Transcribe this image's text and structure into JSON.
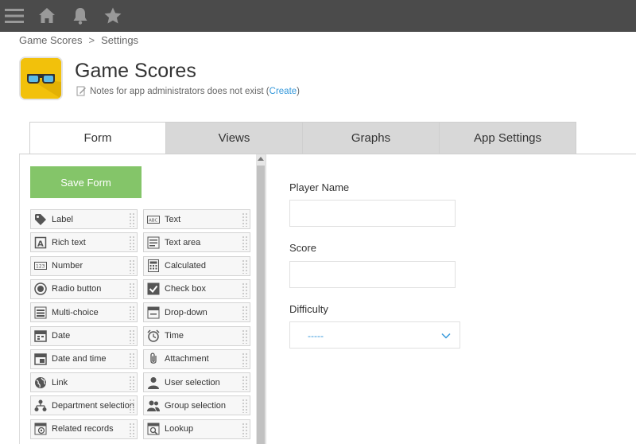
{
  "topbar": {
    "icons": [
      "menu-icon",
      "home-icon",
      "bell-icon",
      "star-icon"
    ]
  },
  "breadcrumb": {
    "items": [
      "Game Scores",
      "Settings"
    ],
    "separator": ">"
  },
  "app": {
    "title": "Game Scores",
    "notes_text": "Notes for app administrators does not exist (",
    "notes_link": "Create",
    "notes_close": ")",
    "icon_color": "#f2c10b"
  },
  "tabs": [
    "Form",
    "Views",
    "Graphs",
    "App Settings"
  ],
  "palette": {
    "save_label": "Save Form",
    "items": [
      {
        "label": "Label",
        "icon": "tag-icon"
      },
      {
        "label": "Text",
        "icon": "text-field-icon"
      },
      {
        "label": "Rich text",
        "icon": "rich-text-icon"
      },
      {
        "label": "Text area",
        "icon": "text-area-icon"
      },
      {
        "label": "Number",
        "icon": "number-icon"
      },
      {
        "label": "Calculated",
        "icon": "calculator-icon"
      },
      {
        "label": "Radio button",
        "icon": "radio-icon"
      },
      {
        "label": "Check box",
        "icon": "checkbox-icon"
      },
      {
        "label": "Multi-choice",
        "icon": "multi-choice-icon"
      },
      {
        "label": "Drop-down",
        "icon": "dropdown-icon"
      },
      {
        "label": "Date",
        "icon": "date-icon"
      },
      {
        "label": "Time",
        "icon": "clock-icon"
      },
      {
        "label": "Date and time",
        "icon": "datetime-icon"
      },
      {
        "label": "Attachment",
        "icon": "paperclip-icon"
      },
      {
        "label": "Link",
        "icon": "globe-icon"
      },
      {
        "label": "User selection",
        "icon": "user-icon"
      },
      {
        "label": "Department selection",
        "icon": "org-chart-icon"
      },
      {
        "label": "Group selection",
        "icon": "group-icon"
      },
      {
        "label": "Related records",
        "icon": "related-records-icon"
      },
      {
        "label": "Lookup",
        "icon": "lookup-icon"
      }
    ]
  },
  "form": {
    "fields": [
      {
        "label": "Player Name",
        "type": "text",
        "value": ""
      },
      {
        "label": "Score",
        "type": "text",
        "value": ""
      },
      {
        "label": "Difficulty",
        "type": "select",
        "value": "-----"
      }
    ]
  },
  "colors": {
    "topbar": "#4b4b4b",
    "save_button": "#84c569",
    "link": "#3498db",
    "tab_inactive": "#d8d8d8"
  }
}
